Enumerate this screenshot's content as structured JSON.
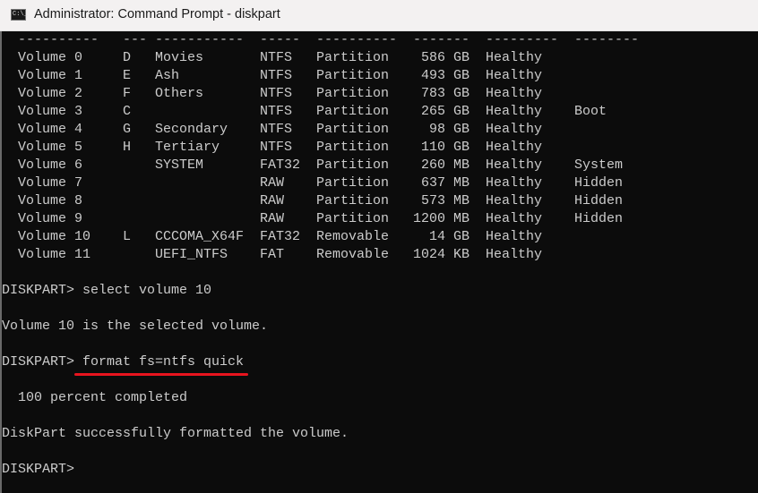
{
  "window": {
    "title": "Administrator: Command Prompt - diskpart",
    "icon": "cmd-icon",
    "icon_text": "C:\\_"
  },
  "separator": [
    "----------",
    "---",
    "-----------",
    "-----",
    "----------",
    "-------",
    "---------",
    "--------"
  ],
  "volumes": [
    [
      "Volume 0",
      "D",
      "Movies",
      "NTFS",
      "Partition",
      "586 GB",
      "Healthy",
      ""
    ],
    [
      "Volume 1",
      "E",
      "Ash",
      "NTFS",
      "Partition",
      "493 GB",
      "Healthy",
      ""
    ],
    [
      "Volume 2",
      "F",
      "Others",
      "NTFS",
      "Partition",
      "783 GB",
      "Healthy",
      ""
    ],
    [
      "Volume 3",
      "C",
      "",
      "NTFS",
      "Partition",
      "265 GB",
      "Healthy",
      "Boot"
    ],
    [
      "Volume 4",
      "G",
      "Secondary",
      "NTFS",
      "Partition",
      "98 GB",
      "Healthy",
      ""
    ],
    [
      "Volume 5",
      "H",
      "Tertiary",
      "NTFS",
      "Partition",
      "110 GB",
      "Healthy",
      ""
    ],
    [
      "Volume 6",
      "",
      "SYSTEM",
      "FAT32",
      "Partition",
      "260 MB",
      "Healthy",
      "System"
    ],
    [
      "Volume 7",
      "",
      "",
      "RAW",
      "Partition",
      "637 MB",
      "Healthy",
      "Hidden"
    ],
    [
      "Volume 8",
      "",
      "",
      "RAW",
      "Partition",
      "573 MB",
      "Healthy",
      "Hidden"
    ],
    [
      "Volume 9",
      "",
      "",
      "RAW",
      "Partition",
      "1200 MB",
      "Healthy",
      "Hidden"
    ],
    [
      "Volume 10",
      "L",
      "CCCOMA_X64F",
      "FAT32",
      "Removable",
      "14 GB",
      "Healthy",
      ""
    ],
    [
      "Volume 11",
      "",
      "UEFI_NTFS",
      "FAT",
      "Removable",
      "1024 KB",
      "Healthy",
      ""
    ]
  ],
  "session": [
    {
      "prompt": "DISKPART> ",
      "command": "select volume 10"
    },
    {
      "output": "Volume 10 is the selected volume."
    },
    {
      "prompt": "DISKPART> ",
      "command": "format fs=ntfs quick"
    },
    {
      "output": "  100 percent completed"
    },
    {
      "output": "DiskPart successfully formatted the volume."
    },
    {
      "prompt": "DISKPART>",
      "command": ""
    }
  ]
}
